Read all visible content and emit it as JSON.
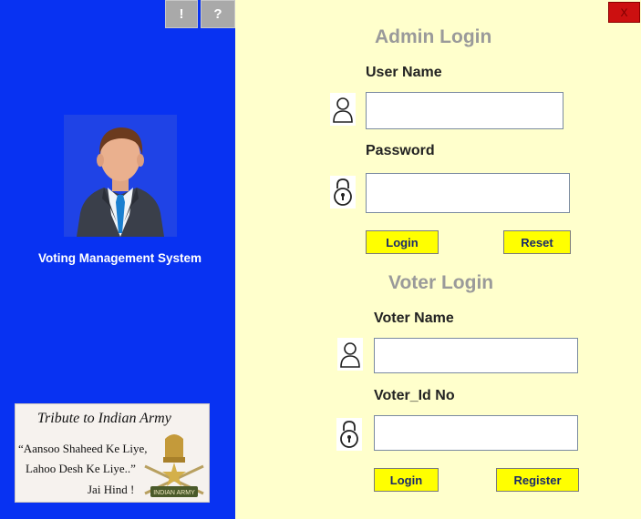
{
  "window": {
    "info_button": "!",
    "help_button": "?",
    "close_button": "X"
  },
  "sidebar": {
    "app_title": "Voting Management System",
    "tribute": {
      "title": "Tribute to Indian Army",
      "line1": "“Aansoo Shaheed Ke Liye,",
      "line2": "Lahoo Desh Ke Liye..”",
      "line3": "Jai Hind !",
      "emblem_label": "INDIAN ARMY"
    }
  },
  "admin": {
    "heading": "Admin Login",
    "username_label": "User Name",
    "username_value": "",
    "password_label": "Password",
    "password_value": "",
    "login_button": "Login",
    "reset_button": "Reset"
  },
  "voter": {
    "heading": "Voter Login",
    "name_label": "Voter Name",
    "name_value": "",
    "id_label": "Voter_Id No",
    "id_value": "",
    "login_button": "Login",
    "register_button": "Register"
  },
  "colors": {
    "sidebar_bg": "#0832f2",
    "main_bg": "#ffffcc",
    "button_bg": "#ffff00",
    "close_bg": "#cc1010"
  }
}
